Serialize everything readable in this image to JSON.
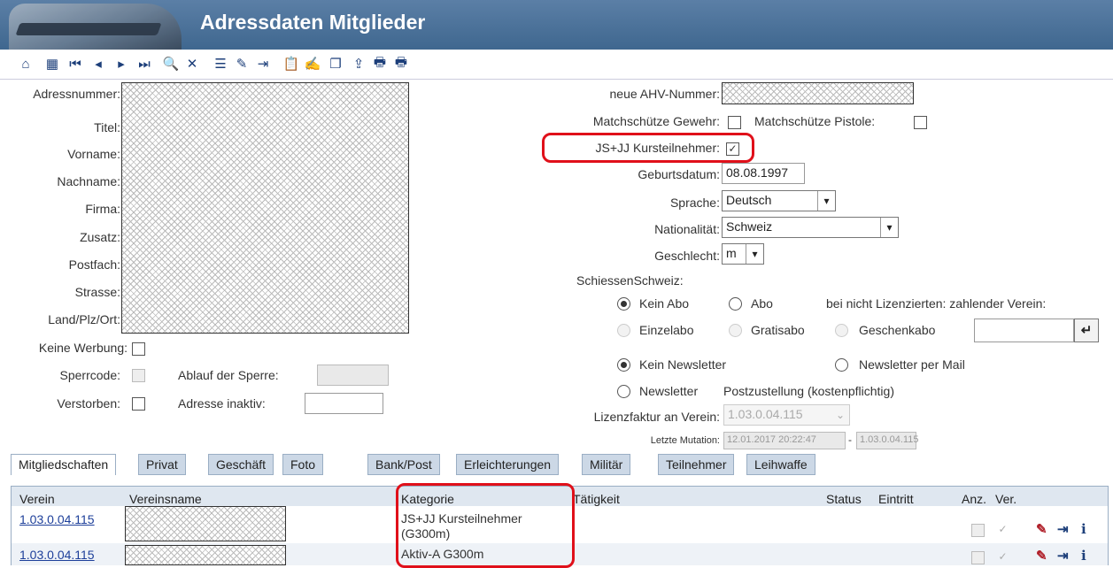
{
  "header": {
    "title": "Adressdaten Mitglieder"
  },
  "toolbar": {
    "icons": [
      "home-icon",
      "select-record-icon",
      "first-record-icon",
      "prev-record-icon",
      "next-record-icon",
      "last-record-icon",
      "search-icon",
      "delete-icon",
      "list-icon",
      "edit-record-icon",
      "export-icon",
      "paste-icon",
      "edit-icon",
      "new-copy-icon",
      "upload-icon",
      "print-icon",
      "print-list-icon"
    ]
  },
  "labels": {
    "adressnummer": "Adressnummer:",
    "titel": "Titel:",
    "vorname": "Vorname:",
    "nachname": "Nachname:",
    "firma": "Firma:",
    "zusatz": "Zusatz:",
    "postfach": "Postfach:",
    "strasse": "Strasse:",
    "land": "Land/Plz/Ort:",
    "keine_werbung": "Keine Werbung:",
    "sperrcode": "Sperrcode:",
    "ablauf": "Ablauf der Sperre:",
    "verstorben": "Verstorben:",
    "adresse_inaktiv": "Adresse inaktiv:",
    "ahv": "neue AHV-Nummer:",
    "match_gewehr": "Matchschütze Gewehr:",
    "match_pistole": "Matchschütze Pistole:",
    "js_jj": "JS+JJ Kursteilnehmer:",
    "geburtsdatum": "Geburtsdatum:",
    "sprache": "Sprache:",
    "nationalitaet": "Nationalität:",
    "geschlecht": "Geschlecht:",
    "schiessen": "SchiessenSchweiz:",
    "kein_abo": "Kein Abo",
    "abo": "Abo",
    "bei_nicht": "bei nicht Lizenzierten: zahlender Verein:",
    "einzelabo": "Einzelabo",
    "gratisabo": "Gratisabo",
    "geschenkabo": "Geschenkabo",
    "kein_newsletter": "Kein Newsletter",
    "newsletter_mail": "Newsletter per Mail",
    "newsletter": "Newsletter",
    "postzustellung": "Postzustellung (kostenpflichtig)",
    "lizenzfaktur": "Lizenzfaktur an Verein:",
    "letzte_mutation": "Letzte Mutation:"
  },
  "values": {
    "geburtsdatum": "08.08.1997",
    "sprache": "Deutsch",
    "nationalitaet": "Schweiz",
    "geschlecht": "m",
    "lizenzfaktur": "1.03.0.04.115",
    "mutation_date": "12.01.2017 20:22:47",
    "mutation_sep": "-",
    "mutation_user": "1.03.0.04.115",
    "js_jj_checked": "✓"
  },
  "tabs": [
    "Mitgliedschaften",
    "Privat",
    "Geschäft",
    "Foto",
    "Bank/Post",
    "Erleichterungen",
    "Militär",
    "Teilnehmer",
    "Leihwaffe"
  ],
  "grid": {
    "headers": [
      "Verein",
      "Vereinsname",
      "Kategorie",
      "Tätigkeit",
      "Status",
      "Eintritt",
      "Anz.",
      "Ver."
    ],
    "rows": [
      {
        "verein": "1.03.0.04.115",
        "kategorie_1": "JS+JJ Kursteilnehmer",
        "kategorie_2": "(G300m)",
        "ver": "✓"
      },
      {
        "verein": "1.03.0.04.115",
        "kategorie_1": "Aktiv-A G300m",
        "ver": "✓"
      }
    ]
  },
  "colors": {
    "header": "#4a6f98",
    "highlight": "#e0101a",
    "link": "#1d3f9a",
    "tab": "#ccd8e6"
  }
}
